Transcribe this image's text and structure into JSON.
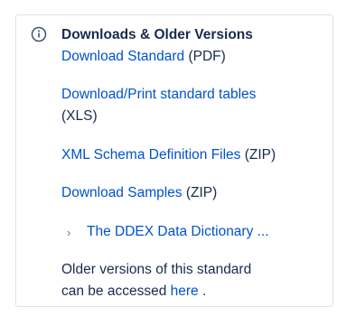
{
  "panel": {
    "heading": "Downloads & Older Versions",
    "items": [
      {
        "link": "Download Standard",
        "suffix": " (PDF)"
      },
      {
        "link": "Download/Print standard tables",
        "suffix": "(XLS)"
      },
      {
        "link": "XML Schema Definition Files",
        "suffix": " (ZIP)"
      },
      {
        "link": "Download Samples",
        "suffix": " (ZIP)"
      }
    ],
    "expand": {
      "chevron": "›",
      "label": "The DDEX Data Dictionary ..."
    },
    "older": {
      "line1": "Older versions of this standard",
      "line2_prefix": "can be accessed ",
      "line2_link": "here",
      "line2_suffix": " ."
    }
  },
  "colors": {
    "link": "#0052cc",
    "text": "#172b4d",
    "border": "#dfe1e5",
    "icon": "#42526e"
  },
  "icons": {
    "info": "info-icon",
    "chevron": "chevron-right-icon"
  }
}
